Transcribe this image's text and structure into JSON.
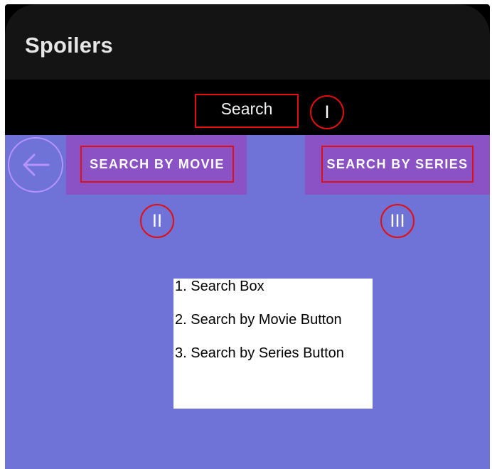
{
  "app": {
    "title": "Spoilers"
  },
  "search": {
    "label": "Search",
    "marker": "I"
  },
  "back": {
    "icon": "arrow-left-icon"
  },
  "tabs": [
    {
      "label": "SEARCH BY MOVIE",
      "marker": "II"
    },
    {
      "label": "SEARCH BY SERIES",
      "marker": "III"
    }
  ],
  "legend": {
    "items": [
      "1. Search Box",
      "2. Search by Movie Button",
      "3. Search by Series Button"
    ]
  },
  "colors": {
    "titlebar": "#141414",
    "content_bg": "#6f72d6",
    "button_bg": "#8a52c4",
    "annotation": "#e01010",
    "back_ring": "#b493ff"
  }
}
